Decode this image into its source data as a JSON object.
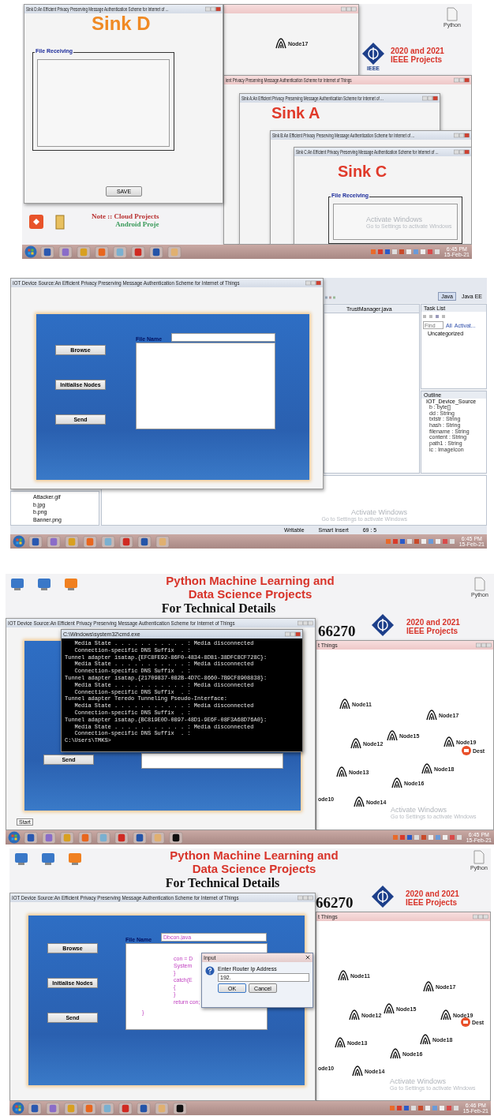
{
  "screens": [
    {
      "kind": "sinks",
      "desktop": {
        "banner_lines": [
          "2020 and 2021",
          "IEEE Projects"
        ],
        "logo_caption": "IEEE",
        "note": "Note :: Cloud Projects",
        "note_2": "Android Proje",
        "file_label": "Python",
        "activation": [
          "Activate Windows",
          "Go to Settings to activate Windows"
        ]
      },
      "back_node": "Node17",
      "windows": [
        {
          "title": "ient Privacy Preserving Message Authentication Scheme for Internet of Things"
        },
        {
          "title": "Sink A:An Efficient Privacy Preserving Message Authentication Scheme for Internet of ...",
          "heading": "Sink A",
          "color": "#e03a2a"
        },
        {
          "title": "Sink B:An Efficient Privacy Preserving Message Authentication Scheme for Internet of ..."
        },
        {
          "title": "Sink C:An Efficient Privacy Preserving Message Authentication Scheme for Internet of ...",
          "heading": "Sink C",
          "color": "#e03a2a",
          "group_label": "File Receiving"
        },
        {
          "title": "Sink D:An Efficient Privacy Preserving Message Authentication Scheme for Internet of ...",
          "heading": "Sink D",
          "color": "#f08a24",
          "group_label": "File Receiving",
          "button": "SAVE"
        }
      ],
      "taskbar": {
        "time": "6:45 PM",
        "date": "15-Feb-21"
      }
    },
    {
      "kind": "ide",
      "app_window": {
        "title": "IOT Device Source:An Efficient Privacy Preserving Message Authentication Scheme for Internet of Things",
        "buttons": [
          "Browse",
          "Initialise Nodes",
          "Send"
        ],
        "file_name_label": "File Name"
      },
      "ide": {
        "perspectives": [
          {
            "label": "Java",
            "selected": true
          },
          {
            "label": "Java EE",
            "selected": false
          }
        ],
        "editor_tab": "TrustManager.java",
        "task_list": {
          "title": "Task List",
          "find_placeholder": "Find",
          "filters": [
            "All",
            "Activat..."
          ],
          "category": "Uncategorized"
        },
        "outline": {
          "title": "Outline",
          "root": "IOT_Device_Source",
          "fields": [
            "b : byte[]",
            "dd : String",
            "txtstr : String",
            "hash : String",
            "filename : String",
            "content : String",
            "path1 : String",
            "ic : ImageIcon"
          ]
        },
        "files": [
          "Attacker.gif",
          "b.jpg",
          "b.png",
          "Banner.png"
        ],
        "status": [
          "Writable",
          "Smart Insert",
          "69 : 5"
        ]
      },
      "activation": [
        "Activate Windows",
        "Go to Settings to activate Windows"
      ],
      "taskbar": {
        "time": "6:45 PM",
        "date": "15-Feb-21"
      }
    },
    {
      "kind": "console",
      "desktop": {
        "headline": [
          "Python Machine Learning and",
          "Data Science Projects"
        ],
        "subline": "For Technical Details",
        "phone_fragment": "66270",
        "banner_lines": [
          "2020 and 2021",
          "IEEE Projects"
        ],
        "file_label": "Python",
        "activation": [
          "Activate Windows",
          "Go to Settings to activate Windows"
        ]
      },
      "back_window_title": "t Things",
      "nodes": [
        "Node11",
        "Node17",
        "Node12",
        "Node15",
        "Node19",
        "Node13",
        "Node18",
        "Node16",
        "ode10",
        "Node14"
      ],
      "dest_label": "Dest",
      "app_window": {
        "title": "IOT Device Source:An Efficient Privacy Preserving Message Authentication Scheme for Internet of Things",
        "buttons": [
          "Send"
        ]
      },
      "console": {
        "title": "C:\\Windows\\system32\\cmd.exe",
        "lines": [
          "   Media State . . . . . . . . . . . : Media disconnected",
          "   Connection-specific DNS Suffix  . :",
          "Tunnel adapter isatap.{EFC8FE92-86F0-4834-8D81-38DFC8CF728C}:",
          "   Media State . . . . . . . . . . . : Media disconnected",
          "   Connection-specific DNS Suffix  . :",
          "Tunnel adapter isatap.{21709837-082B-4D7C-8660-7B9CF8908838}:",
          "   Media State . . . . . . . . . . . : Media disconnected",
          "   Connection-specific DNS Suffix  . :",
          "Tunnel adapter Teredo Tunneling Pseudo-Interface:",
          "   Media State . . . . . . . . . . . : Media disconnected",
          "   Connection-specific DNS Suffix  . :",
          "Tunnel adapter isatap.{BC819E0D-0897-48D1-9E6F-08F3A68D76A0}:",
          "   Media State . . . . . . . . . . . : Media disconnected",
          "   Connection-specific DNS Suffix  . :",
          "C:\\Users\\TMKS>"
        ]
      },
      "start_tooltip": "Start",
      "taskbar": {
        "time": "6:45 PM",
        "date": "15-Feb-21"
      }
    },
    {
      "kind": "dialog",
      "desktop": {
        "headline": [
          "Python Machine Learning and",
          "Data Science Projects"
        ],
        "subline": "For Technical Details",
        "phone_fragment": "66270",
        "banner_lines": [
          "2020 and 2021",
          "IEEE Projects"
        ],
        "file_label": "Python",
        "activation": [
          "Activate Windows",
          "Go to Settings to activate Windows"
        ]
      },
      "back_window_title": "t Things",
      "nodes": [
        "Node11",
        "Node17",
        "Node12",
        "Node15",
        "Node19",
        "Node13",
        "Node18",
        "Node16",
        "ode10",
        "Node14"
      ],
      "dest_label": "Dest",
      "app_window": {
        "title": "IOT Device Source:An Efficient Privacy Preserving Message Authentication Scheme for Internet of Things",
        "buttons": [
          "Browse",
          "Initialise Nodes",
          "Send"
        ],
        "file_name_label": "File Name",
        "file_name_value": "Dbcon.java",
        "code_lines": [
          "con = D",
          "System",
          "}",
          "catch(E",
          "{",
          "}",
          "return con;"
        ],
        "code_closing": "}"
      },
      "dialog": {
        "title": "Input",
        "prompt": "Enter Router Ip Address",
        "value": "192.",
        "buttons": [
          "OK",
          "Cancel"
        ]
      },
      "taskbar": {
        "time": "6:46 PM",
        "date": "15-Feb-21"
      }
    }
  ]
}
